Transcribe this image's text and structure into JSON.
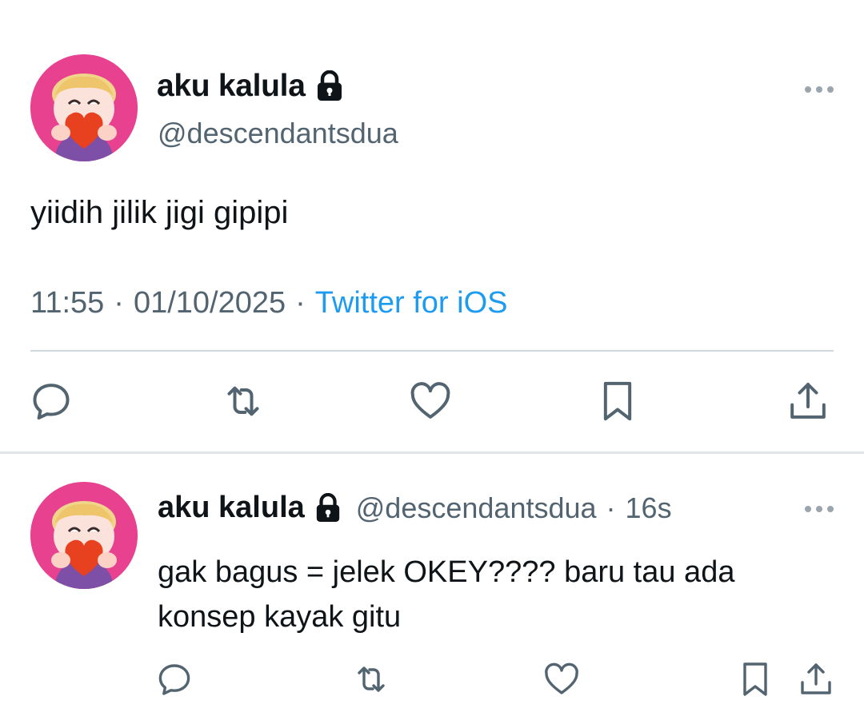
{
  "main_tweet": {
    "display_name": "aku kalula",
    "handle": "@descendantsdua",
    "text": "yiidih jilik jigi gipipi",
    "time": "11:55",
    "separator": "·",
    "date": "01/10/2025",
    "source": "Twitter for iOS"
  },
  "reply": {
    "display_name": "aku kalula",
    "handle": "@descendantsdua",
    "separator": "·",
    "age": "16s",
    "text": "gak bagus = jelek OKEY???? baru tau ada konsep kayak gitu"
  },
  "colors": {
    "accent": "#1d9bf0",
    "secondary_text": "#536471",
    "primary_text": "#0f1419",
    "divider": "#cfd9de",
    "avatar_bg": "#e8418f"
  },
  "icons": [
    "lock-icon",
    "more-icon",
    "reply-icon",
    "retweet-icon",
    "like-icon",
    "bookmark-icon",
    "share-icon"
  ]
}
